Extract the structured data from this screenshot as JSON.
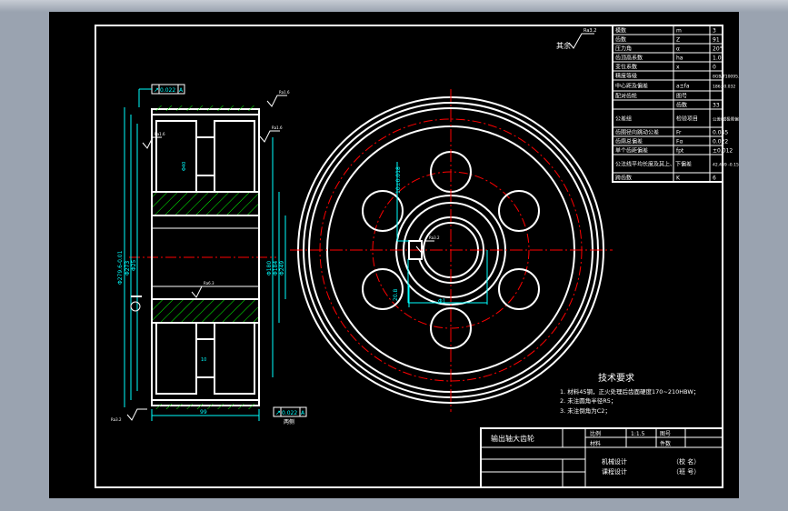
{
  "colors": {
    "background": "#000000",
    "outline": "#ffffff",
    "dimension": "#00ffff",
    "centerline": "#ff0000",
    "hatch": "#00ff00",
    "frame": "#9aa3b0"
  },
  "surface_finish": {
    "label": "其余",
    "value": "Ra3.2"
  },
  "params_table": [
    {
      "name": "模数",
      "symbol": "m",
      "value": "3"
    },
    {
      "name": "齿数",
      "symbol": "Z",
      "value": "91"
    },
    {
      "name": "压力角",
      "symbol": "α",
      "value": "20°"
    },
    {
      "name": "齿顶高系数",
      "symbol": "ha",
      "value": "1.0"
    },
    {
      "name": "变位系数",
      "symbol": "x",
      "value": "0"
    },
    {
      "name": "精度等级",
      "symbol": "",
      "value": "8GB/T10095.1-2001"
    },
    {
      "name": "中心距及偏差",
      "symbol": "a±fa",
      "value": "186±0.032"
    },
    {
      "name": "配对齿轮",
      "symbol": "图号",
      "value": ""
    },
    {
      "name": "",
      "symbol": "齿数",
      "value": "33"
    },
    {
      "name": "公差组",
      "symbol": "检验项目",
      "value": "公差(或极限偏差)值"
    },
    {
      "name": "齿圈径向跳动公差",
      "symbol": "Fr",
      "value": "0.045"
    },
    {
      "name": "齿廓总偏差",
      "symbol": "Fα",
      "value": "0.022"
    },
    {
      "name": "单个齿距偏差",
      "symbol": "fpt",
      "value": "±0.012"
    },
    {
      "name": "公法线平均长度及其上、下偏差",
      "symbol": "",
      "value": "42.439 -0.15 -0.22"
    },
    {
      "name": "跨齿数",
      "symbol": "K",
      "value": "6"
    }
  ],
  "tolerance_frames": [
    {
      "symbol": "↗",
      "value": "0.022",
      "datum": "A"
    },
    {
      "symbol": "↗",
      "value": "0.022",
      "datum": "A"
    }
  ],
  "roughness_marks": [
    "Ra1.6",
    "Ra1.6",
    "Ra1.6",
    "Ra6.3",
    "Ra3.2"
  ],
  "side_dims": {
    "outer": "Φ279.6-0.01",
    "tip": "Φ273",
    "web": "Φ25",
    "hub1": "Φ180",
    "hub2": "Φ184",
    "bore": "Φ249",
    "width": "99",
    "slot": "10",
    "hole": "Φ40",
    "thick": "20",
    "base_label": "两侧"
  },
  "front_dims": {
    "keyway_width": "10±0.018",
    "keyway_depth": "20.8",
    "hub_dia": "Φ1",
    "key_ra": "Ra3.2"
  },
  "tech_requirements": {
    "title": "技术要求",
    "items": [
      "1. 材料45钢，正火处理后齿面硬度170~210HBW；",
      "2. 未注圆角半径R5；",
      "3. 未注倒角为C2；"
    ]
  },
  "title_block": {
    "part_name": "输出轴大齿轮",
    "scale_label": "比例",
    "scale_value": "1:1.5",
    "sheet_label": "图号",
    "material_label": "材料",
    "qty_label": "件数",
    "designer_label": "机械设计",
    "course_label": "课程设计",
    "school": "（校 名）",
    "class_no": "（班 号）"
  }
}
